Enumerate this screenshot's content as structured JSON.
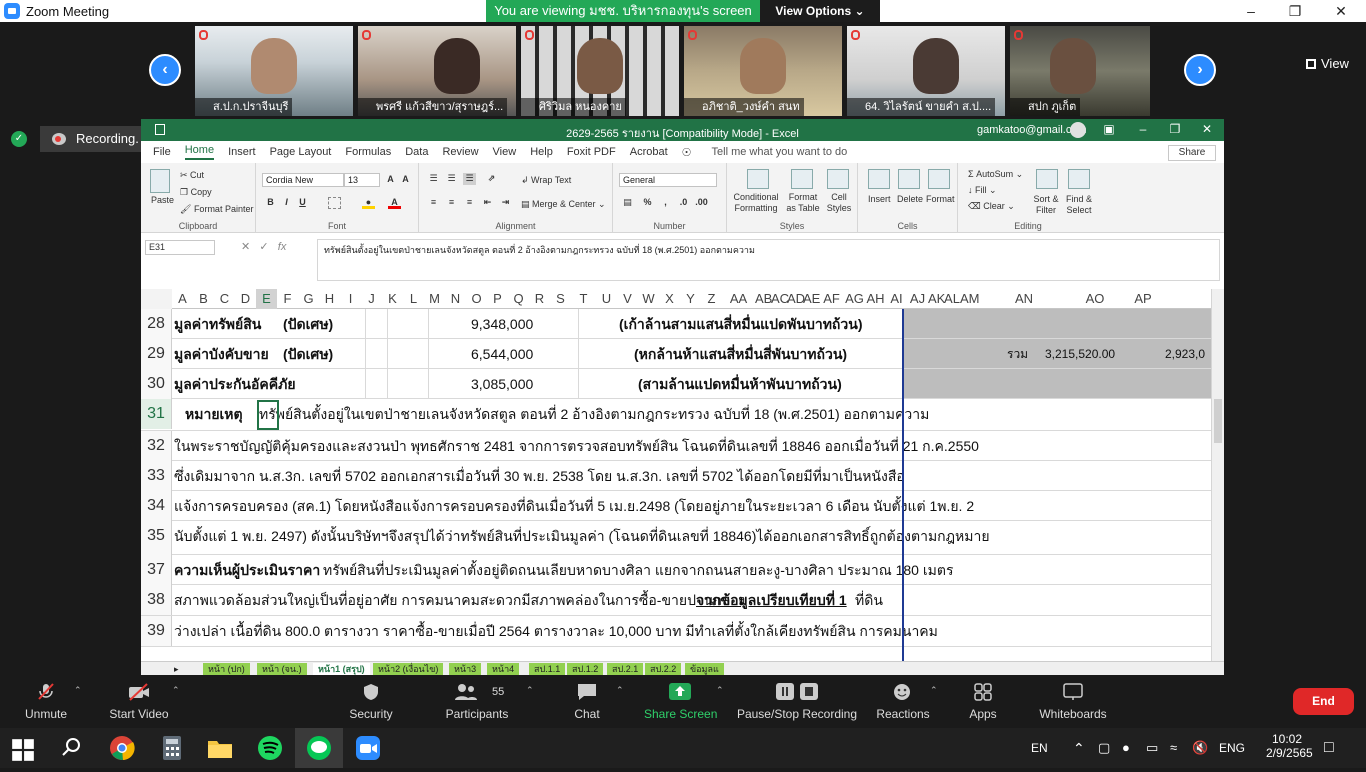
{
  "zoom": {
    "title": "Zoom Meeting",
    "viewing_banner": "You are viewing มชช. บริหารกองทุน's screen",
    "view_options": "View Options",
    "view_label": "View",
    "recording_label": "Recording...",
    "participants": [
      {
        "name": "ส.ป.ก.ปราจีนบุรี"
      },
      {
        "name": "พรศรี แก้วสีขาว/สุราษฎร์..."
      },
      {
        "name": "ศิริวิมล หนองคาย"
      },
      {
        "name": "อภิชาติ_วงษ์คำ สนท"
      },
      {
        "name": "64. วิไลรัตน์ ขายคำ ส.ป...."
      },
      {
        "name": "สปก ภูเก็ต"
      }
    ],
    "toolbar": {
      "unmute": "Unmute",
      "start_video": "Start Video",
      "security": "Security",
      "participants": "Participants",
      "participants_count": "55",
      "chat": "Chat",
      "share_screen": "Share Screen",
      "pause_stop": "Pause/Stop Recording",
      "reactions": "Reactions",
      "apps": "Apps",
      "whiteboards": "Whiteboards",
      "end": "End"
    }
  },
  "excel": {
    "title": "2629-2565 รายงาน  [Compatibility Mode]  -  Excel",
    "account": "gamkatoo@gmail.com",
    "menu": [
      "File",
      "Home",
      "Insert",
      "Page Layout",
      "Formulas",
      "Data",
      "Review",
      "View",
      "Help",
      "Foxit PDF",
      "Acrobat"
    ],
    "tell_me": "Tell me what you want to do",
    "share": "Share",
    "ribbon": {
      "paste": "Paste",
      "cut": "Cut",
      "copy": "Copy",
      "format_painter": "Format Painter",
      "clipboard": "Clipboard",
      "font_name": "Cordia New",
      "font_size": "13",
      "font": "Font",
      "wrap_text": "Wrap Text",
      "merge_center": "Merge & Center",
      "alignment": "Alignment",
      "number_format": "General",
      "number": "Number",
      "conditional": "Conditional Formatting",
      "format_as_table": "Format as Table",
      "cell_styles": "Cell Styles",
      "styles": "Styles",
      "insert": "Insert",
      "delete": "Delete",
      "format": "Format",
      "cells": "Cells",
      "autosum": "AutoSum",
      "fill": "Fill",
      "clear": "Clear",
      "sort_filter": "Sort & Filter",
      "find_select": "Find & Select",
      "editing": "Editing"
    },
    "name_box": "E31",
    "formula": "ทรัพย์สินตั้งอยู่ในเขตป่าชายเลนจังหวัดสตูล ตอนที่ 2 อ้างอิงตามกฎกระทรวง ฉบับที่ 18 (พ.ศ.2501) ออกตามความ",
    "columns": [
      "A",
      "B",
      "C",
      "D",
      "E",
      "F",
      "G",
      "H",
      "I",
      "J",
      "K",
      "L",
      "M",
      "N",
      "O",
      "P",
      "Q",
      "R",
      "S",
      "T",
      "U",
      "V",
      "W",
      "X",
      "Y",
      "Z",
      "AA",
      "AB",
      "AC",
      "AD",
      "AE",
      "AF",
      "AG",
      "AH",
      "AI",
      "AJ",
      "AK",
      "AL",
      "AM",
      "AN",
      "AO",
      "AP"
    ],
    "rows": [
      {
        "n": "28",
        "a": "มูลค่าทรัพย์สิน",
        "f": "(ปัดเศษ)",
        "val": "9,348,000",
        "words": "(เก้าล้านสามแสนสี่หมื่นแปดพันบาทถ้วน)"
      },
      {
        "n": "29",
        "a": "มูลค่าบังคับขาย",
        "f": "(ปัดเศษ)",
        "val": "6,544,000",
        "words": "(หกล้านห้าแสนสี่หมื่นสี่พันบาทถ้วน)",
        "sum_label": "รวม",
        "an": "3,215,520.00",
        "ap": "2,923,0"
      },
      {
        "n": "30",
        "a": "มูลค่าประกันอัคคีภัย",
        "f": "",
        "val": "3,085,000",
        "words": "(สามล้านแปดหมื่นห้าพันบาทถ้วน)"
      },
      {
        "n": "31",
        "note_label": "หมายเหตุ",
        "text": "ทรัพย์สินตั้งอยู่ในเขตป่าชายเลนจังหวัดสตูล ตอนที่ 2 อ้างอิงตามกฎกระทรวง ฉบับที่ 18 (พ.ศ.2501) ออกตามความ"
      },
      {
        "n": "32",
        "text": "ในพระราชบัญญัติคุ้มครองและสงวนป่า พุทธศักราช 2481 จากการตรวจสอบทรัพย์สิน โฉนดที่ดินเลขที่ 18846 ออกเมื่อวันที่ 21  ก.ค.2550"
      },
      {
        "n": "33",
        "text": "ซึ่งเดิมมาจาก น.ส.3ก. เลขที่ 5702 ออกเอกสารเมื่อวันที่ 30 พ.ย. 2538 โดย น.ส.3ก. เลขที่ 5702 ได้ออกโดยมีที่มาเป็นหนังสือ"
      },
      {
        "n": "34",
        "text": "แจ้งการครอบครอง (สค.1)  โดยหนังสือแจ้งการครอบครองที่ดินเมื่อวันที่ 5 เม.ย.2498 (โดยอยู่ภายในระยะเวลา 6 เดือน นับตั้งแต่  1พ.ย. 2"
      },
      {
        "n": "35",
        "text": "นับตั้งแต่  1 พ.ย. 2497) ดังนั้นบริษัทฯจึงสรุปได้ว่าทรัพย์สินที่ประเมินมูลค่า (โฉนดที่ดินเลขที่ 18846)ได้ออกเอกสารสิทธิ์ถูกต้องตามกฎหมาย"
      },
      {
        "n": "37",
        "label": "ความเห็นผู้ประเมินราคา",
        "text": "ทรัพย์สินที่ประเมินมูลค่าตั้งอยู่ติดถนนเลียบหาดบางศิลา แยกจากถนนสายละงู-บางศิลา ประมาณ 180 เมตร"
      },
      {
        "n": "38",
        "text": "สภาพแวดล้อมส่วนใหญ่เป็นที่อยู่อาศัย การคมนาคมสะดวกมีสภาพคล่องในการซื้อ-ขายปานกลาง",
        "u": "จากข้อมูลเปรียบเทียบที่ 1",
        "tail": "ที่ดิน"
      },
      {
        "n": "39",
        "text": "ว่างเปล่า เนื้อที่ดิน 800.0 ตารางวา ราคาซื้อ-ขายเมื่อปี 2564 ตารางวาละ 10,000 บาท มีทำเลที่ตั้งใกล้เคียงทรัพย์สิน การคมนาคม"
      }
    ],
    "sheets": [
      "หน้า (ปก)",
      "หน้า (จน.)",
      "หน้า1 (สรุป)",
      "หน้า2 (เงื่อนไข)",
      "หน้า3",
      "หน้า4",
      "สป.1.1",
      "สป.1.2",
      "สป.2.1",
      "สป.2.2",
      "ข้อมูลแ"
    ]
  },
  "taskbar": {
    "lang1": "EN",
    "lang2": "ENG",
    "time": "10:02",
    "date": "2/9/2565"
  }
}
